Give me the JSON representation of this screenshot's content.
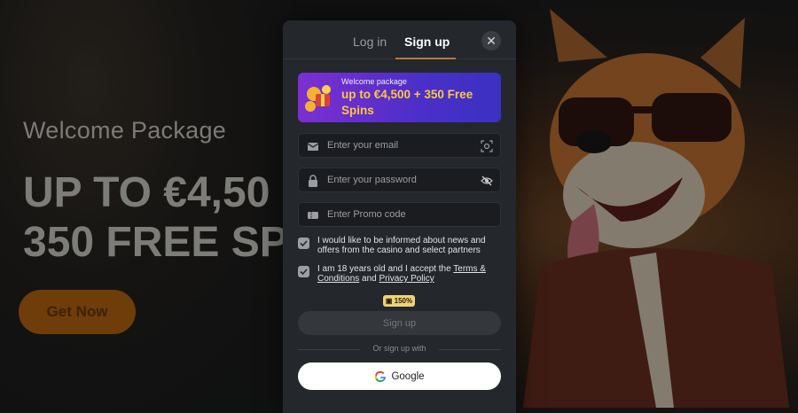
{
  "hero": {
    "subtitle": "Welcome Package",
    "title_line1": "UP TO €4,50",
    "title_line2": "350 FREE SP",
    "cta_label": "Get Now"
  },
  "modal": {
    "tabs": [
      {
        "label": "Log in",
        "active": false
      },
      {
        "label": "Sign up",
        "active": true
      }
    ],
    "close_icon": "close-icon",
    "banner": {
      "small": "Welcome package",
      "big": "up to €4,500 + 350 Free Spins"
    },
    "fields": {
      "email_placeholder": "Enter your email",
      "password_placeholder": "Enter your password",
      "promo_placeholder": "Enter Promo code"
    },
    "checkboxes": {
      "news": "I would like to be informed about news and offers from the casino and select partners",
      "age_prefix": "I am 18 years old and I accept the",
      "terms_link": "Terms & Conditions",
      "and": "and",
      "privacy_link": "Privacy Policy"
    },
    "bonus_badge": "150%",
    "signup_button": "Sign up",
    "divider_text": "Or sign up with",
    "google_button": "Google"
  },
  "colors": {
    "accent": "#b57a3a",
    "banner_gold": "#ffc642",
    "banner_purple": "#7d2fd1",
    "cta_orange": "#6e3d09"
  }
}
